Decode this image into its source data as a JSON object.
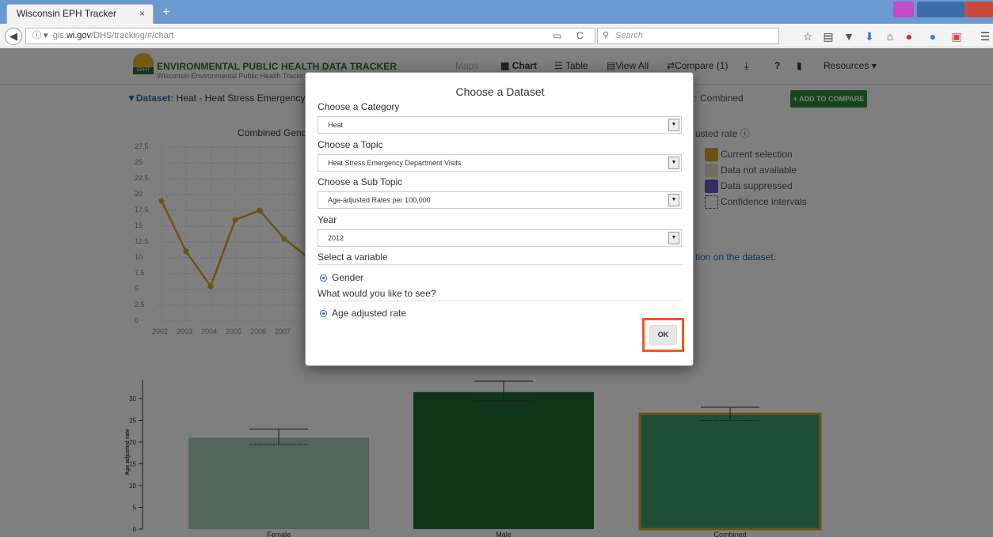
{
  "browser": {
    "tab_title": "Wisconsin EPH Tracker",
    "tab_close": "×",
    "new_tab": "+",
    "url_prefix": "gis.",
    "url_domain": "wi.gov",
    "url_path": "/DHS/tracking/#/chart",
    "search_placeholder": "Search",
    "reload_glyph": "C"
  },
  "site": {
    "title": "ENVIRONMENTAL PUBLIC HEALTH DATA TRACKER",
    "subtitle": "Wisconsin Environmental Public Health Tracking Program",
    "logo_text": "EPHT",
    "nav": {
      "maps": "Maps",
      "chart": "Chart",
      "table": "Table",
      "view_all": "View All",
      "compare": "Compare (1)",
      "help": "?",
      "resources": "Resources"
    }
  },
  "dataset_bar": {
    "label": "Dataset:",
    "value": "Heat - Heat Stress Emergency Department Visits",
    "combined_prefix": "s:",
    "combined_value": "Combined",
    "add_to_compare": "ADD TO COMPARE"
  },
  "line_chart": {
    "title": "Combined Gender"
  },
  "legend": {
    "title": "usted rate",
    "items": [
      {
        "label": "Current selection",
        "color": "#d9a62b"
      },
      {
        "label": "Data not available",
        "color": "#e8d8c8"
      },
      {
        "label": "Data suppressed",
        "color": "#6a5ac8"
      },
      {
        "label": "Confidence intervals",
        "color": "#ffffff"
      }
    ],
    "info_text": "tion on the dataset."
  },
  "chart_data": [
    {
      "type": "line",
      "title": "Combined Gender",
      "x": [
        2002,
        2003,
        2004,
        2005,
        2006,
        2007
      ],
      "y": [
        19,
        11,
        5.5,
        16,
        17.5,
        13
      ],
      "ylim": [
        0,
        27.5
      ],
      "yticks": [
        0,
        2.5,
        5,
        7.5,
        10,
        12.5,
        15,
        17.5,
        20,
        22.5,
        25,
        27.5
      ],
      "xticks": [
        "2002",
        "2003",
        "2004",
        "2005",
        "2006",
        "2007"
      ],
      "color": "#d9a62b",
      "grid": true
    },
    {
      "type": "bar",
      "ylabel": "Age adjusted rate",
      "categories": [
        "Female",
        "Male",
        "Combined"
      ],
      "values": [
        21,
        31.5,
        26.5
      ],
      "ci_low": [
        19.5,
        29.5,
        25
      ],
      "ci_high": [
        23,
        34,
        28
      ],
      "yticks": [
        0,
        5,
        10,
        15,
        20,
        25,
        30
      ],
      "ylim": [
        0,
        35
      ],
      "colors": [
        "#a6cbb9",
        "#1e6b31",
        "#3a9a6f"
      ],
      "selected_border": "#d9a62b"
    }
  ],
  "modal": {
    "title": "Choose a Dataset",
    "category_label": "Choose a Category",
    "category_value": "Heat",
    "topic_label": "Choose a Topic",
    "topic_value": "Heat Stress Emergency Department Visits",
    "subtopic_label": "Choose a Sub Topic",
    "subtopic_value": "Age-adjusted Rates per 100,000",
    "year_label": "Year",
    "year_value": "2012",
    "variable_label": "Select a variable",
    "variable_option": "Gender",
    "see_label": "What would you like to see?",
    "see_option": "Age adjusted rate",
    "ok_label": "OK",
    "highlight_color": "#f05a1e"
  }
}
